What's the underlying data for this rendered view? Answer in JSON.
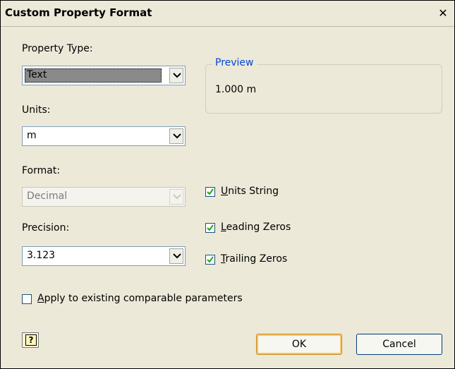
{
  "window": {
    "title": "Custom Property Format",
    "close_glyph": "✕"
  },
  "fields": {
    "property_type_label": "Property Type:",
    "property_type_value": "Text",
    "units_label": "Units:",
    "units_value": "m",
    "format_label": "Format:",
    "format_value": "Decimal",
    "precision_label": "Precision:",
    "precision_value": "3.123"
  },
  "preview": {
    "legend": "Preview",
    "value": "1.000 m"
  },
  "checkboxes": {
    "units_string": {
      "mnemonic": "U",
      "rest": "nits String",
      "checked": true
    },
    "leading_zeros": {
      "mnemonic": "L",
      "rest": "eading Zeros",
      "checked": true
    },
    "trailing_zeros": {
      "mnemonic": "T",
      "rest": "railing Zeros",
      "checked": true
    },
    "apply_existing": {
      "mnemonic": "A",
      "rest": "pply to existing comparable parameters",
      "checked": false
    }
  },
  "buttons": {
    "ok": "OK",
    "cancel": "Cancel",
    "help": "?"
  },
  "icons": {
    "dropdown": "chevron-down-icon",
    "help": "help-icon",
    "close": "close-icon",
    "check": "check-icon"
  }
}
